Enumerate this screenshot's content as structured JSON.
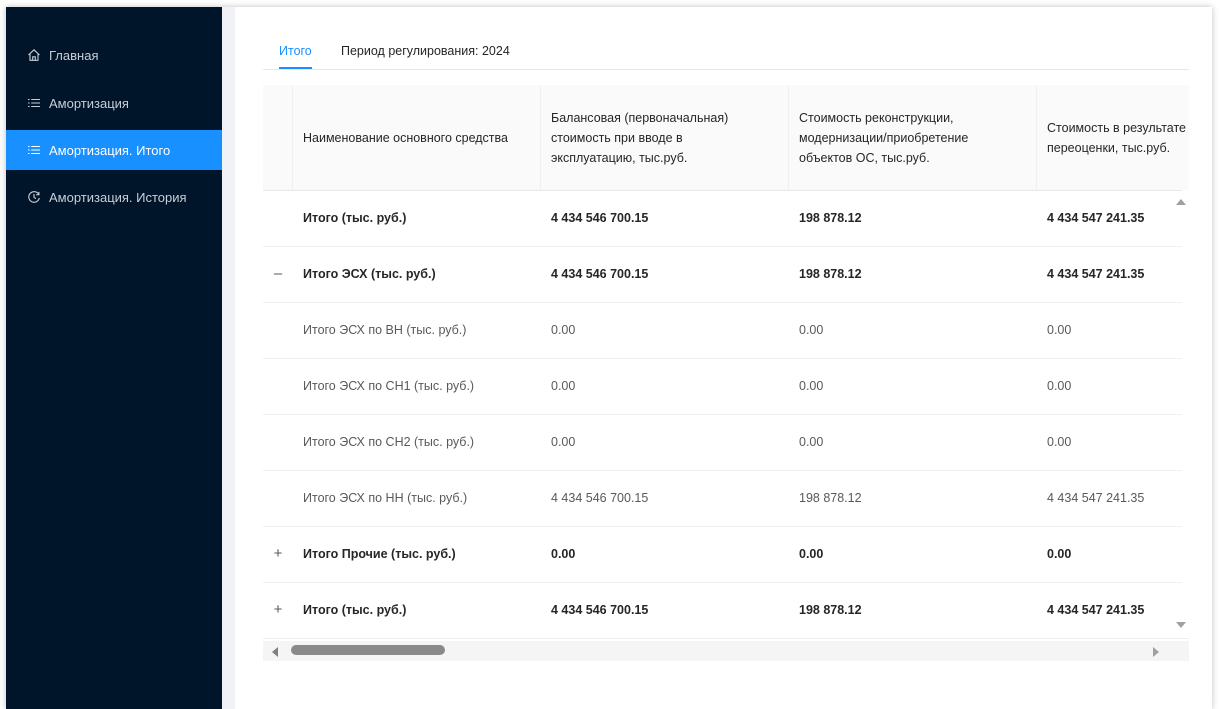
{
  "sidebar": {
    "items": [
      {
        "label": "Главная",
        "icon": "home-icon",
        "active": false
      },
      {
        "label": "Амортизация",
        "icon": "list-icon",
        "active": false
      },
      {
        "label": "Амортизация. Итого",
        "icon": "list-icon",
        "active": true
      },
      {
        "label": "Амортизация. История",
        "icon": "history-icon",
        "active": false
      }
    ]
  },
  "tabs": {
    "active_label": "Итого",
    "period_label": "Период регулирования: 2024"
  },
  "table": {
    "columns": [
      "Наименование основного средства",
      "Балансовая (первоначальная) стоимость при вводе в эксплуатацию, тыс.руб.",
      "Стоимость реконструкции, модернизации/приобретение объектов ОС, тыс.руб.",
      "Стоимость в результате переоценки, тыс.руб."
    ],
    "rows": [
      {
        "expander": "",
        "name": "Итого (тыс. руб.)",
        "c1": "4 434 546 700.15",
        "c2": "198 878.12",
        "c3": "4 434 547 241.35",
        "bold": true
      },
      {
        "expander": "–",
        "name": "Итого ЭСХ (тыс. руб.)",
        "c1": "4 434 546 700.15",
        "c2": "198 878.12",
        "c3": "4 434 547 241.35",
        "bold": true
      },
      {
        "expander": "",
        "name": "Итого ЭСХ по ВН (тыс. руб.)",
        "c1": "0.00",
        "c2": "0.00",
        "c3": "0.00",
        "bold": false
      },
      {
        "expander": "",
        "name": "Итого ЭСХ по СН1 (тыс. руб.)",
        "c1": "0.00",
        "c2": "0.00",
        "c3": "0.00",
        "bold": false
      },
      {
        "expander": "",
        "name": "Итого ЭСХ по СН2 (тыс. руб.)",
        "c1": "0.00",
        "c2": "0.00",
        "c3": "0.00",
        "bold": false
      },
      {
        "expander": "",
        "name": "Итого ЭСХ по НН (тыс. руб.)",
        "c1": "4 434 546 700.15",
        "c2": "198 878.12",
        "c3": "4 434 547 241.35",
        "bold": false
      },
      {
        "expander": "+",
        "name": "Итого Прочие (тыс. руб.)",
        "c1": "0.00",
        "c2": "0.00",
        "c3": "0.00",
        "bold": true
      },
      {
        "expander": "+",
        "name": "Итого (тыс. руб.)",
        "c1": "4 434 546 700.15",
        "c2": "198 878.12",
        "c3": "4 434 547 241.35",
        "bold": true
      }
    ]
  },
  "colors": {
    "sidebar_bg": "#001529",
    "accent": "#1890ff",
    "header_bg": "#fafafa"
  }
}
